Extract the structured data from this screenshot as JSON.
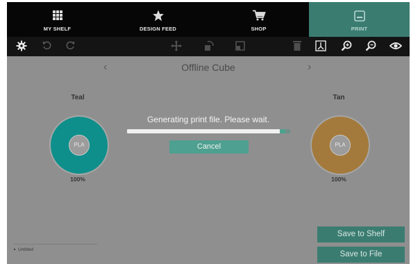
{
  "nav": {
    "tabs": [
      {
        "label": "MY SHELF",
        "icon": "grid-icon"
      },
      {
        "label": "DESIGN FEED",
        "icon": "star-icon"
      },
      {
        "label": "SHOP",
        "icon": "cart-icon"
      },
      {
        "label": "PRINT",
        "icon": "print-icon"
      }
    ],
    "active_tab": "PRINT"
  },
  "toolbar": {
    "icons": [
      "gear-icon",
      "undo-icon",
      "redo-icon",
      "move-icon",
      "rotate-icon",
      "scale-icon",
      "delete-icon",
      "view-icon",
      "zoom-in-icon",
      "zoom-out-icon",
      "eye-icon"
    ]
  },
  "model": {
    "title": "Offline Cube",
    "prev_glyph": "‹",
    "next_glyph": "›"
  },
  "spools": {
    "left": {
      "name": "Teal",
      "material": "PLA",
      "percent": "100%",
      "color": "#0e8f8b"
    },
    "right": {
      "name": "Tan",
      "material": "PLA",
      "percent": "100%",
      "color": "#a47a3c"
    }
  },
  "progress": {
    "message": "Generating print file. Please wait.",
    "fraction": 0.97,
    "cancel_label": "Cancel"
  },
  "files": {
    "items": [
      "Untitled"
    ]
  },
  "actions": {
    "save_to_shelf": "Save to Shelf",
    "save_to_file": "Save to File"
  },
  "colors": {
    "accent": "#3b7c71",
    "button": "#4ea090",
    "background": "#8f8f8f",
    "nav": "#060606"
  }
}
